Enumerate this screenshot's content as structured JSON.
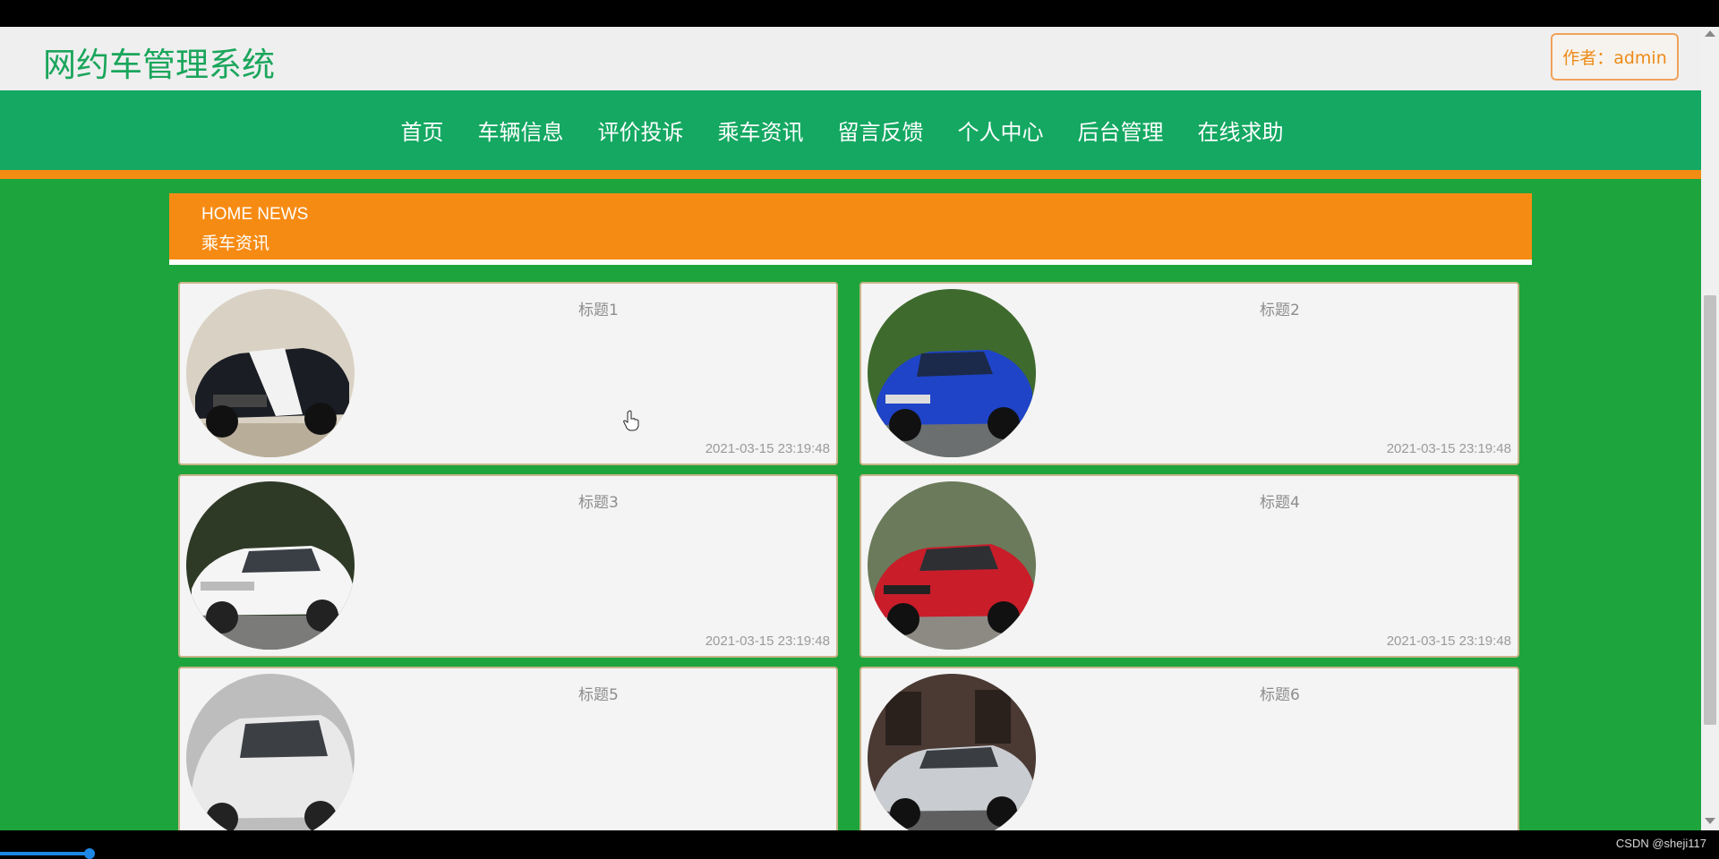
{
  "header": {
    "site_title": "网约车管理系统",
    "author_label": "作者：admin"
  },
  "nav": {
    "items": [
      {
        "label": "首页"
      },
      {
        "label": "车辆信息"
      },
      {
        "label": "评价投诉"
      },
      {
        "label": "乘车资讯"
      },
      {
        "label": "留言反馈"
      },
      {
        "label": "个人中心"
      },
      {
        "label": "后台管理"
      },
      {
        "label": "在线求助"
      }
    ]
  },
  "banner": {
    "english": "HOME NEWS",
    "chinese": "乘车资讯"
  },
  "news": [
    {
      "title": "标题1",
      "time": "2021-03-15 23:19:48",
      "car_color": "#1a1d24",
      "stripe_color": "#f2f2f2",
      "bg_color": "#d9d2c4"
    },
    {
      "title": "标题2",
      "time": "2021-03-15 23:19:48",
      "car_color": "#1f44c8",
      "stripe_color": "#1f44c8",
      "bg_color": "#3f6a2e"
    },
    {
      "title": "标题3",
      "time": "2021-03-15 23:19:48",
      "car_color": "#f5f5f5",
      "stripe_color": "#f5f5f5",
      "bg_color": "#2e3a26"
    },
    {
      "title": "标题4",
      "time": "2021-03-15 23:19:48",
      "car_color": "#c91d2a",
      "stripe_color": "#c91d2a",
      "bg_color": "#6b7a5a"
    },
    {
      "title": "标题5",
      "time": "",
      "car_color": "#e9e9ea",
      "stripe_color": "#e9e9ea",
      "bg_color": "#bdbdbd"
    },
    {
      "title": "标题6",
      "time": "",
      "car_color": "#c9ccd1",
      "stripe_color": "#c9ccd1",
      "bg_color": "#4a3a33"
    }
  ],
  "footer": {
    "watermark": "CSDN @sheji117"
  },
  "colors": {
    "page_bg": "#1ea43c",
    "nav_bg": "#14a862",
    "accent_orange": "#f68b14",
    "title_green": "#1aa65b"
  }
}
